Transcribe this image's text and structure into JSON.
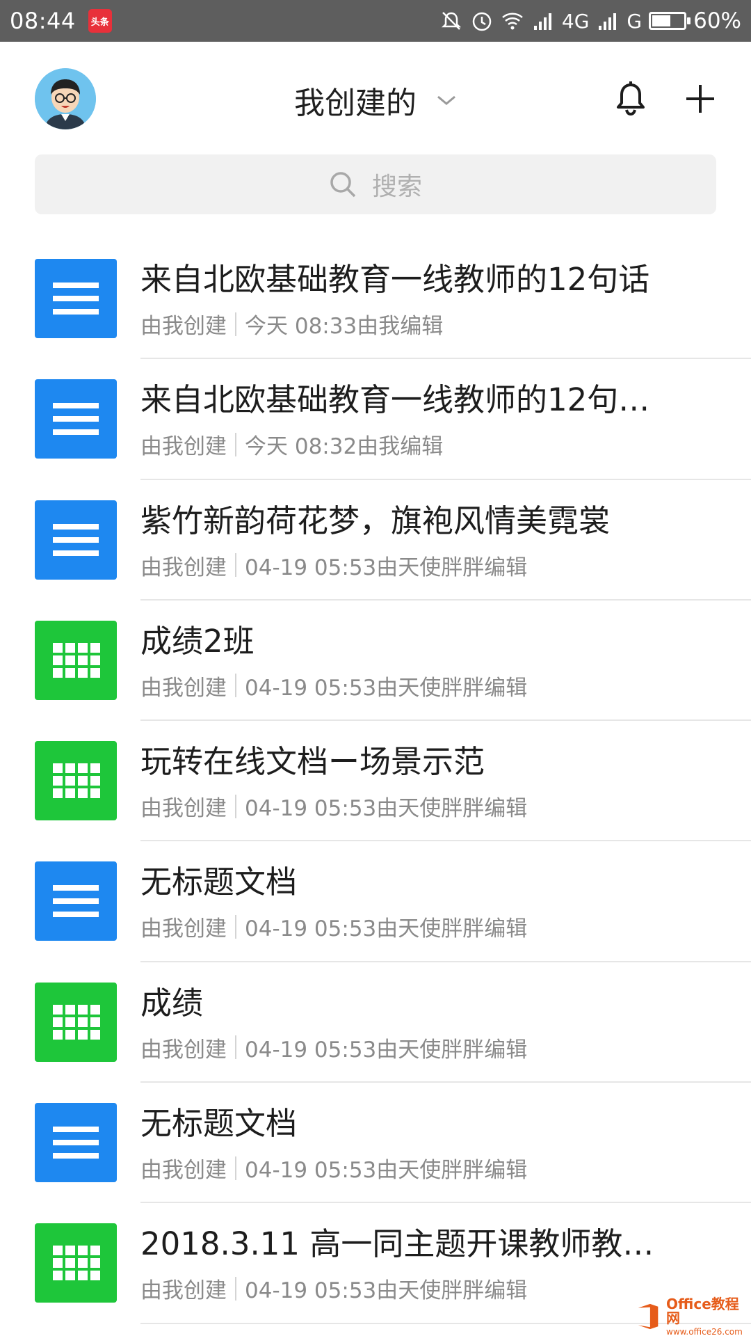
{
  "status_bar": {
    "time": "08:44",
    "app_badge": "头条",
    "network_1": "4G",
    "network_2": "G",
    "battery_percent": "60%",
    "battery_level": 0.6
  },
  "header": {
    "title": "我创建的",
    "icons": [
      "avatar",
      "chevron-down-icon",
      "bell-icon",
      "plus-icon"
    ]
  },
  "search": {
    "placeholder": "搜索"
  },
  "documents": [
    {
      "type": "doc",
      "title": "来自北欧基础教育一线教师的12句话",
      "creator": "由我创建",
      "edited": "今天 08:33由我编辑"
    },
    {
      "type": "doc",
      "title": "来自北欧基础教育一线教师的12句…",
      "creator": "由我创建",
      "edited": "今天 08:32由我编辑"
    },
    {
      "type": "doc",
      "title": "紫竹新韵荷花梦，旗袍风情美霓裳",
      "creator": "由我创建",
      "edited": "04-19 05:53由天使胖胖编辑"
    },
    {
      "type": "sheet",
      "title": "成绩2班",
      "creator": "由我创建",
      "edited": "04-19 05:53由天使胖胖编辑"
    },
    {
      "type": "sheet",
      "title": "玩转在线文档ー场景示范",
      "creator": "由我创建",
      "edited": "04-19 05:53由天使胖胖编辑"
    },
    {
      "type": "doc",
      "title": "无标题文档",
      "creator": "由我创建",
      "edited": "04-19 05:53由天使胖胖编辑"
    },
    {
      "type": "sheet",
      "title": "成绩",
      "creator": "由我创建",
      "edited": "04-19 05:53由天使胖胖编辑"
    },
    {
      "type": "doc",
      "title": "无标题文档",
      "creator": "由我创建",
      "edited": "04-19 05:53由天使胖胖编辑"
    },
    {
      "type": "sheet",
      "title": "2018.3.11 高一同主题开课教师教…",
      "creator": "由我创建",
      "edited": "04-19 05:53由天使胖胖编辑"
    }
  ],
  "watermark": {
    "line1": "Office教程网",
    "line2": "www.office26.com"
  },
  "colors": {
    "doc_blue": "#1e88f0",
    "sheet_green": "#1ec63a",
    "status_bar": "#5e5e5e"
  }
}
